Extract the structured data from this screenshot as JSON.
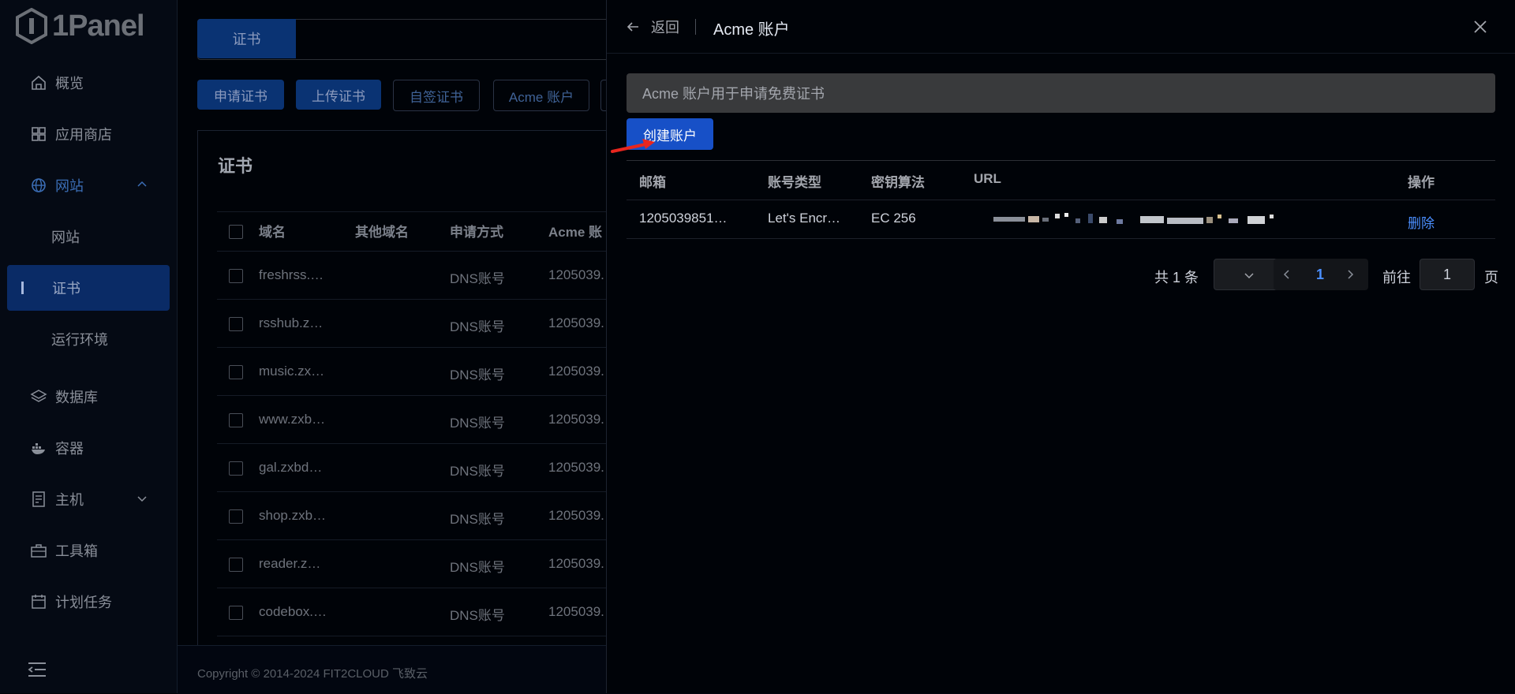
{
  "sidebar": {
    "brand": "1Panel",
    "items": [
      {
        "label": "概览",
        "icon": "home-icon"
      },
      {
        "label": "应用商店",
        "icon": "grid-icon"
      },
      {
        "label": "网站",
        "icon": "globe-icon"
      },
      {
        "label": "网站",
        "icon": ""
      },
      {
        "label": "证书",
        "icon": ""
      },
      {
        "label": "运行环境",
        "icon": ""
      },
      {
        "label": "数据库",
        "icon": "layers-icon"
      },
      {
        "label": "容器",
        "icon": "docker-icon"
      },
      {
        "label": "主机",
        "icon": "server-icon"
      },
      {
        "label": "工具箱",
        "icon": "toolbox-icon"
      },
      {
        "label": "计划任务",
        "icon": "calendar-icon"
      }
    ]
  },
  "main": {
    "tab_label": "证书",
    "buttons": [
      "申请证书",
      "上传证书",
      "自签证书",
      "Acme 账户"
    ],
    "card_title": "证书",
    "columns": [
      "域名",
      "其他域名",
      "申请方式",
      "Acme 账"
    ],
    "rows": [
      {
        "domain": "freshrss.…",
        "method": "DNS账号",
        "acme": "1205039."
      },
      {
        "domain": "rsshub.z…",
        "method": "DNS账号",
        "acme": "1205039."
      },
      {
        "domain": "music.zx…",
        "method": "DNS账号",
        "acme": "1205039."
      },
      {
        "domain": "www.zxb…",
        "method": "DNS账号",
        "acme": "1205039."
      },
      {
        "domain": "gal.zxbd…",
        "method": "DNS账号",
        "acme": "1205039."
      },
      {
        "domain": "shop.zxb…",
        "method": "DNS账号",
        "acme": "1205039."
      },
      {
        "domain": "reader.z…",
        "method": "DNS账号",
        "acme": "1205039."
      },
      {
        "domain": "codebox.…",
        "method": "DNS账号",
        "acme": "1205039."
      }
    ],
    "footer": "Copyright © 2014-2024 FIT2CLOUD 飞致云"
  },
  "drawer": {
    "back_label": "返回",
    "title": "Acme 账户",
    "alert": "Acme 账户用于申请免费证书",
    "create_label": "创建账户",
    "columns": {
      "email": "邮箱",
      "type": "账号类型",
      "algo": "密钥算法",
      "url": "URL",
      "ops": "操作"
    },
    "rows": [
      {
        "email": "1205039851…",
        "type": "Let's Encr…",
        "algo": "EC 256",
        "action": "删除"
      }
    ],
    "pagination": {
      "total": "共 1 条",
      "page": "1",
      "goto_label": "前往",
      "goto_value": "1",
      "page_suffix": "页"
    }
  },
  "colors": {
    "accent": "#1750c7",
    "link": "#4b8fff",
    "annotation_arrow": "#e8261e"
  }
}
